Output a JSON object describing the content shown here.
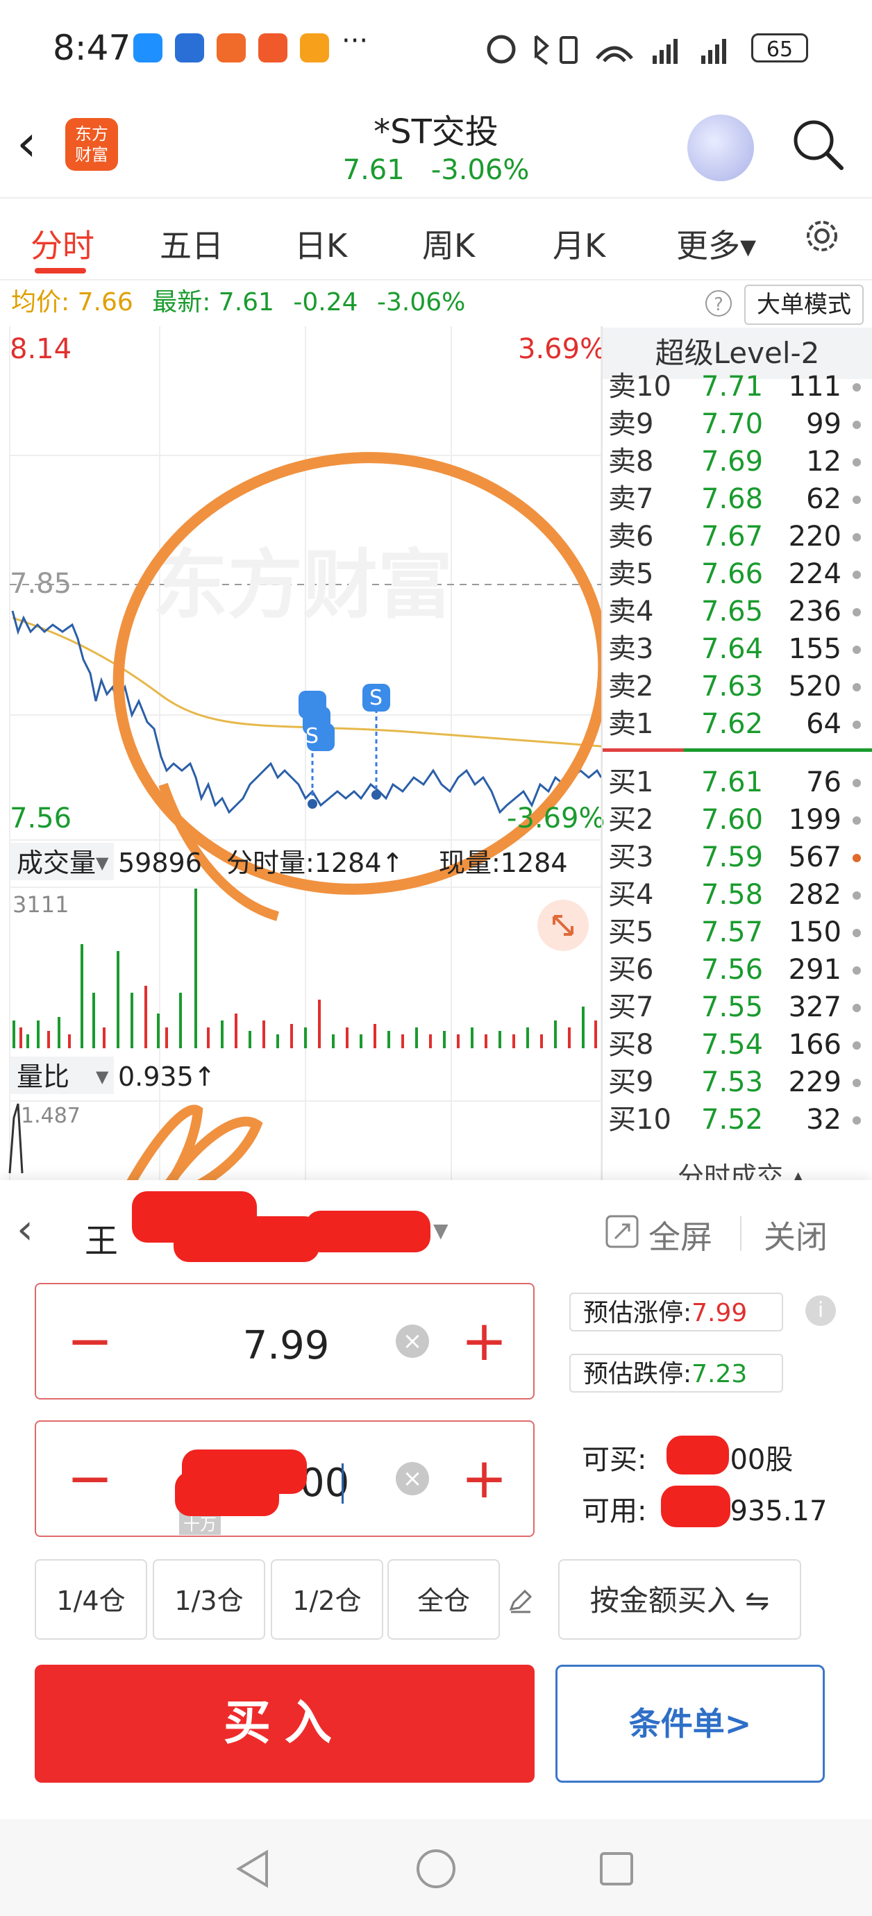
{
  "status_bar": {
    "time": "8:47",
    "more": "···",
    "battery": "65"
  },
  "header": {
    "back": "‹",
    "logo_text": "东方\n财富",
    "stock_name": "*ST交投",
    "price": "7.61",
    "change_pct": "-3.06%"
  },
  "tabs": [
    {
      "label": "分时",
      "active": true
    },
    {
      "label": "五日",
      "active": false
    },
    {
      "label": "日K",
      "active": false
    },
    {
      "label": "周K",
      "active": false
    },
    {
      "label": "月K",
      "active": false
    },
    {
      "label": "更多▾",
      "active": false
    }
  ],
  "info_row": {
    "avg_label": "均价:",
    "avg_value": "7.66",
    "latest_label": "最新:",
    "latest_value": "7.61",
    "change": "-0.24",
    "change_pct": "-3.06%",
    "help": "?",
    "big_order_mode": "大单模式"
  },
  "chart": {
    "y_high": "8.14",
    "y_mid": "7.85",
    "y_low": "7.56",
    "pct_high": "3.69%",
    "pct_low": "-3.69%",
    "watermark": "东方财富",
    "marker": "S",
    "volume_label": "成交量",
    "volume_value": "59896",
    "tick_volume": "分时量:1284↑",
    "current_volume": "现量:1284",
    "volume_max": "3111",
    "volratio_label": "量比",
    "volratio_value": "0.935↑",
    "volratio_max": "1.487"
  },
  "order_book": {
    "title": "超级Level-2",
    "asks": [
      {
        "label": "卖10",
        "price": "7.71",
        "vol": "111"
      },
      {
        "label": "卖9",
        "price": "7.70",
        "vol": "99"
      },
      {
        "label": "卖8",
        "price": "7.69",
        "vol": "12"
      },
      {
        "label": "卖7",
        "price": "7.68",
        "vol": "62"
      },
      {
        "label": "卖6",
        "price": "7.67",
        "vol": "220"
      },
      {
        "label": "卖5",
        "price": "7.66",
        "vol": "224"
      },
      {
        "label": "卖4",
        "price": "7.65",
        "vol": "236"
      },
      {
        "label": "卖3",
        "price": "7.64",
        "vol": "155"
      },
      {
        "label": "卖2",
        "price": "7.63",
        "vol": "520"
      },
      {
        "label": "卖1",
        "price": "7.62",
        "vol": "64"
      }
    ],
    "bids": [
      {
        "label": "买1",
        "price": "7.61",
        "vol": "76"
      },
      {
        "label": "买2",
        "price": "7.60",
        "vol": "199"
      },
      {
        "label": "买3",
        "price": "7.59",
        "vol": "567"
      },
      {
        "label": "买4",
        "price": "7.58",
        "vol": "282"
      },
      {
        "label": "买5",
        "price": "7.57",
        "vol": "150"
      },
      {
        "label": "买6",
        "price": "7.56",
        "vol": "291"
      },
      {
        "label": "买7",
        "price": "7.55",
        "vol": "327"
      },
      {
        "label": "买8",
        "price": "7.54",
        "vol": "166"
      },
      {
        "label": "买9",
        "price": "7.53",
        "vol": "229"
      },
      {
        "label": "买10",
        "price": "7.52",
        "vol": "32"
      }
    ],
    "footer": "分时成交 ▴"
  },
  "trade_panel": {
    "back": "‹",
    "account_prefix": "王",
    "fullscreen": "全屏",
    "close": "关闭",
    "price_value": "7.99",
    "qty_value_suffix": "00",
    "qty_unit_hint": "十万",
    "limit_up_label": "预估涨停:",
    "limit_up_value": "7.99",
    "limit_down_label": "预估跌停:",
    "limit_down_value": "7.23",
    "info": "i",
    "can_buy_label": "可买:",
    "can_buy_suffix": "00股",
    "available_label": "可用:",
    "available_suffix": "935.17",
    "positions": [
      "1/4仓",
      "1/3仓",
      "1/2仓",
      "全仓"
    ],
    "by_amount": "按金额买入 ⇋",
    "buy": "买入",
    "conditional": "条件单>"
  },
  "colors": {
    "up": "#e0302e",
    "down": "#1a9b2e",
    "avg": "#e0a000",
    "accent": "#ee3b2b",
    "price_line": "#2b5fa8"
  }
}
